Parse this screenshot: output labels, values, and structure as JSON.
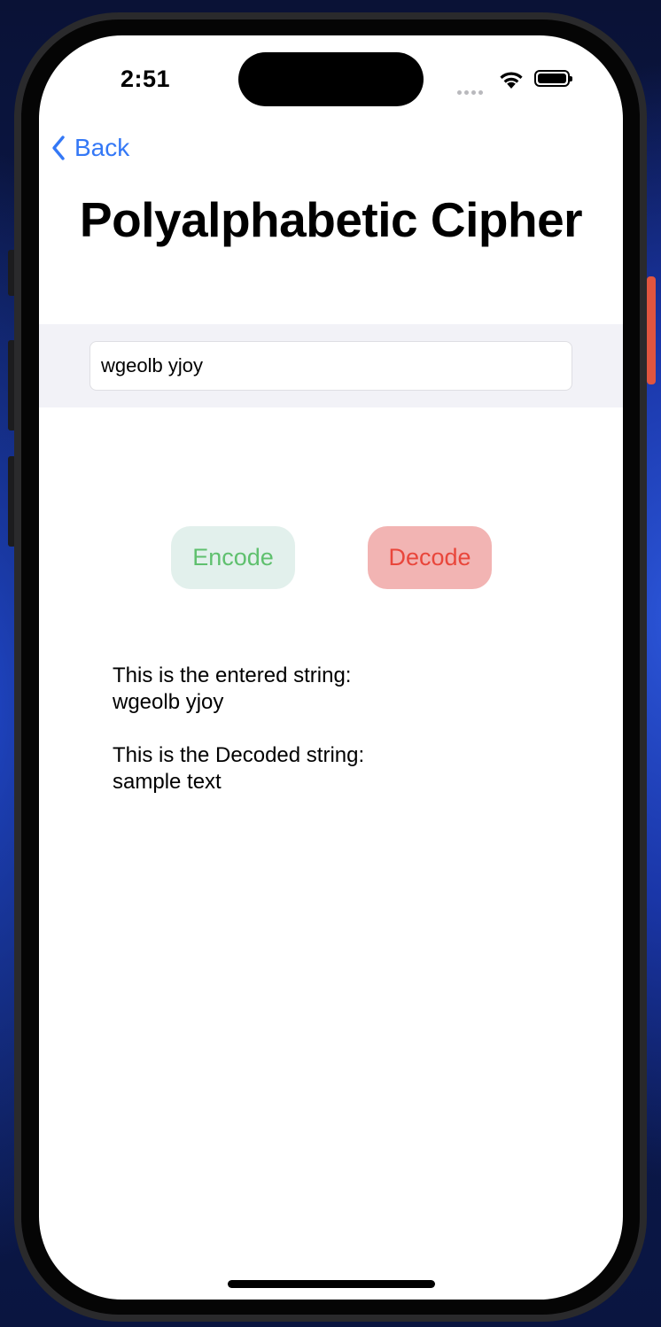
{
  "status_bar": {
    "time": "2:51"
  },
  "nav": {
    "back_label": "Back"
  },
  "page": {
    "title": "Polyalphabetic Cipher"
  },
  "form": {
    "input_value": "wgeolb yjoy"
  },
  "actions": {
    "encode_label": "Encode",
    "decode_label": "Decode"
  },
  "output": {
    "entered_caption": "This is the entered string:",
    "entered_value": "wgeolb yjoy",
    "decoded_caption": "This is the Decoded string:",
    "decoded_value": "sample text"
  },
  "icons": {
    "back": "chevron-left-icon",
    "wifi": "wifi-icon",
    "battery": "battery-icon",
    "signal": "cellular-signal-icon"
  },
  "colors": {
    "accent": "#3478f6",
    "encode_bg": "#e2f0ec",
    "encode_text": "#5fc06e",
    "decode_bg": "#f2b4b3",
    "decode_text": "#e9463b"
  }
}
